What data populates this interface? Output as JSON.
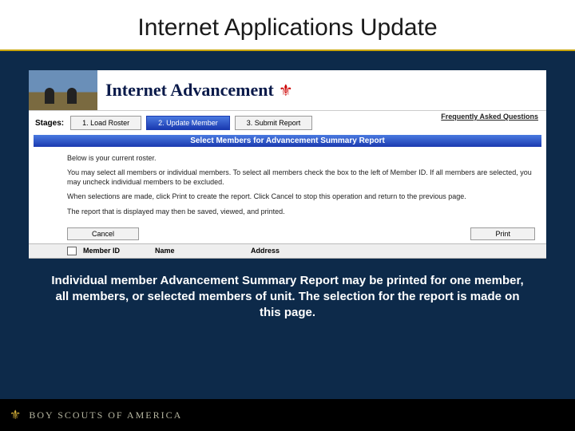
{
  "slide": {
    "title": "Internet Applications Update",
    "caption": "Individual member Advancement Summary Report may be printed for one member, all members, or selected members of unit. The selection for the report is made on this page."
  },
  "app": {
    "title": "Internet Advancement",
    "faq": "Frequently Asked Questions",
    "stages_label": "Stages:",
    "stages": [
      {
        "label": "1. Load Roster",
        "active": false
      },
      {
        "label": "2. Update Member",
        "active": true
      },
      {
        "label": "3. Submit Report",
        "active": false
      }
    ],
    "section_title": "Select Members for Advancement Summary Report",
    "instructions": {
      "p1": "Below is your current roster.",
      "p2": "You may select all members or individual members. To select all members check the box to the left of Member ID. If all members are selected, you may uncheck individual members to be excluded.",
      "p3": "When selections are made, click Print to create the report. Click Cancel to stop this operation and return to the previous page.",
      "p4": "The report that is displayed may then be saved, viewed, and printed."
    },
    "buttons": {
      "cancel": "Cancel",
      "print": "Print"
    },
    "table": {
      "member_id": "Member ID",
      "name": "Name",
      "address": "Address"
    }
  },
  "footer": {
    "brand": "BOY SCOUTS OF AMERICA"
  }
}
